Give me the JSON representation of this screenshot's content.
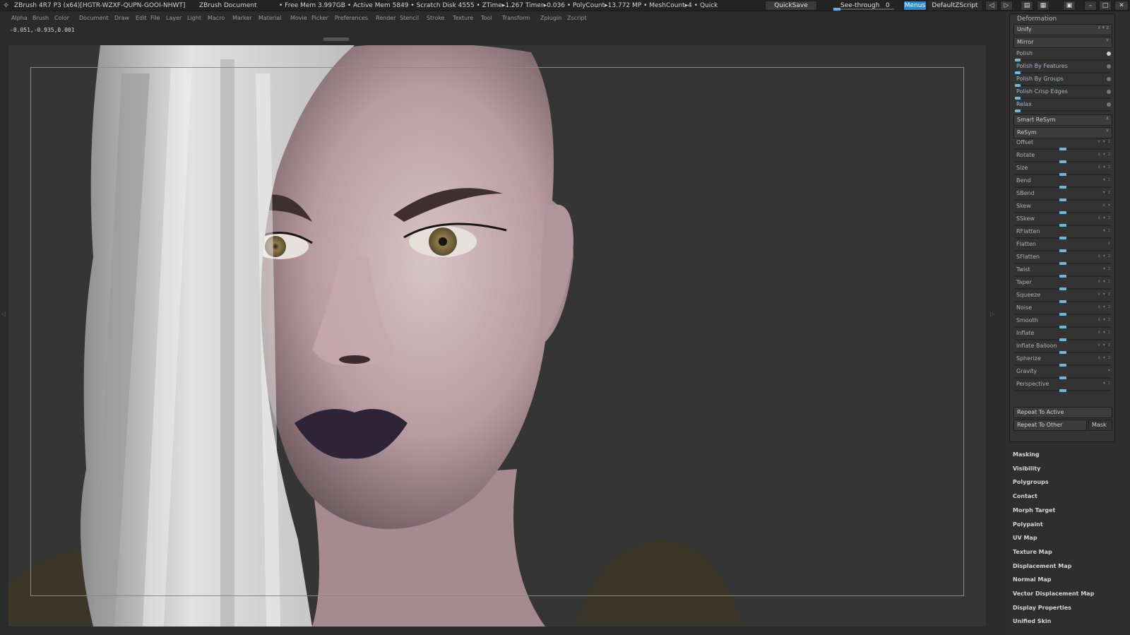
{
  "titlebar": {
    "title": "ZBrush 4R7 P3 (x64)[HGTR-WZXF-QUPN-GOOI-NHWT]",
    "document": "ZBrush Document",
    "stats": "• Free Mem 3.997GB • Active Mem 5849 • Scratch Disk 4555 • ZTime▸1.267 Timer▸0.036 • PolyCount▸13.772 MP • MeshCount▸4 • Quick",
    "quicksave": "QuickSave",
    "see_through": "See-through",
    "see_through_value": "0",
    "see_through_level": 0,
    "menus": "Menus",
    "default_script": "DefaultZScript"
  },
  "menubar": {
    "items": [
      "Alpha",
      "Brush",
      "Color",
      "Document",
      "Draw",
      "Edit",
      "File",
      "Layer",
      "Light",
      "Macro",
      "Marker",
      "Material",
      "Movie",
      "Picker",
      "Preferences",
      "Render",
      "Stencil",
      "Stroke",
      "Texture",
      "Tool",
      "Transform",
      "Zplugin",
      "Zscript"
    ]
  },
  "coords": "-0.051,-0.935,0.001",
  "deformation": {
    "title": "Deformation",
    "unify": "Unify",
    "mirror": "Mirror",
    "polish": [
      {
        "label": "Polish",
        "level": 0
      },
      {
        "label": "Polish By Features",
        "level": 0
      },
      {
        "label": "Polish By Groups",
        "level": 0
      },
      {
        "label": "Polish Crisp Edges",
        "level": 0
      },
      {
        "label": "Relax",
        "level": 0
      }
    ],
    "smart_resym": "Smart ReSym",
    "resym": "ReSym",
    "sliders": [
      {
        "label": "Offset",
        "level": 0.5
      },
      {
        "label": "Rotate",
        "level": 0.5
      },
      {
        "label": "Size",
        "level": 0.5
      },
      {
        "label": "Bend",
        "level": 0.5
      },
      {
        "label": "SBend",
        "level": 0.5
      },
      {
        "label": "Skew",
        "level": 0.5
      },
      {
        "label": "SSkew",
        "level": 0.5
      },
      {
        "label": "RFlatten",
        "level": 0.5
      },
      {
        "label": "Flatten",
        "level": 0.5
      },
      {
        "label": "SFlatten",
        "level": 0.5
      },
      {
        "label": "Twist",
        "level": 0.5
      },
      {
        "label": "Taper",
        "level": 0.5
      },
      {
        "label": "Squeeze",
        "level": 0.5
      },
      {
        "label": "Noise",
        "level": 0.5
      },
      {
        "label": "Smooth",
        "level": 0.5
      },
      {
        "label": "Inflate",
        "level": 0.5
      },
      {
        "label": "Inflate Balloon",
        "level": 0.5
      },
      {
        "label": "Spherize",
        "level": 0.5
      },
      {
        "label": "Gravity",
        "level": 0.5
      },
      {
        "label": "Perspective",
        "level": 0.5
      }
    ],
    "repeat_active": "Repeat To Active",
    "repeat_other": "Repeat To Other",
    "mask": "Mask"
  },
  "subpalettes": [
    "Masking",
    "Visibility",
    "Polygroups",
    "Contact",
    "Morph Target",
    "Polypaint",
    "UV Map",
    "Texture Map",
    "Displacement Map",
    "Normal Map",
    "Vector Displacement Map",
    "Display Properties",
    "Unified Skin"
  ]
}
